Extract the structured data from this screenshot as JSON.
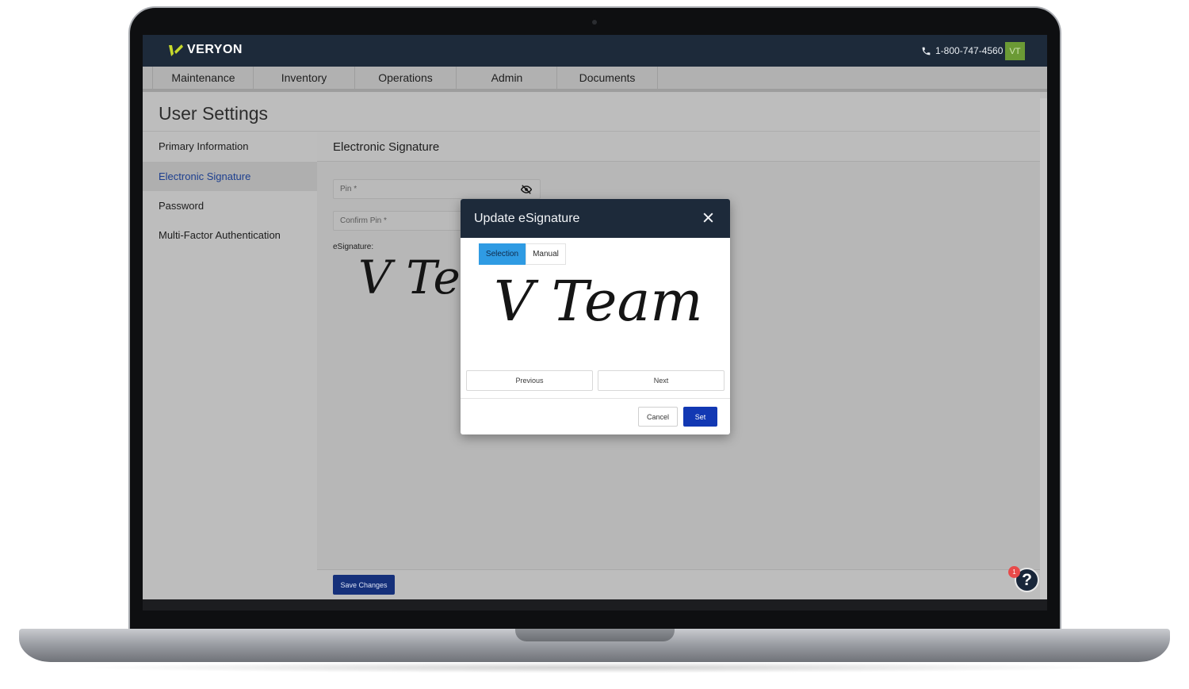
{
  "app": {
    "logo_text": "VERYON",
    "phone": "1-800-747-4560",
    "avatar_initials": "VT",
    "accent": "#c7d92b",
    "header_bg": "#1d2a3a"
  },
  "nav": {
    "tabs": [
      "Maintenance",
      "Inventory",
      "Operations",
      "Admin",
      "Documents"
    ]
  },
  "page": {
    "title": "User Settings"
  },
  "sidebar": {
    "items": [
      "Primary Information",
      "Electronic Signature",
      "Password",
      "Multi-Factor Authentication"
    ],
    "active_index": 1
  },
  "content": {
    "title": "Electronic Signature",
    "pin_placeholder": "Pin *",
    "confirm_pin_placeholder": "Confirm Pin *",
    "esignature_label": "eSignature:",
    "signature_preview_text": "V Te",
    "save_label": "Save Changes"
  },
  "help": {
    "badge_count": "1",
    "glyph": "?"
  },
  "modal": {
    "title": "Update eSignature",
    "close_glyph": "✕",
    "tabs": [
      "Selection",
      "Manual"
    ],
    "selected_tab": "Selection",
    "signature_text": "V Team",
    "previous_label": "Previous",
    "next_label": "Next",
    "cancel_label": "Cancel",
    "set_label": "Set",
    "set_color": "#1238b3"
  }
}
